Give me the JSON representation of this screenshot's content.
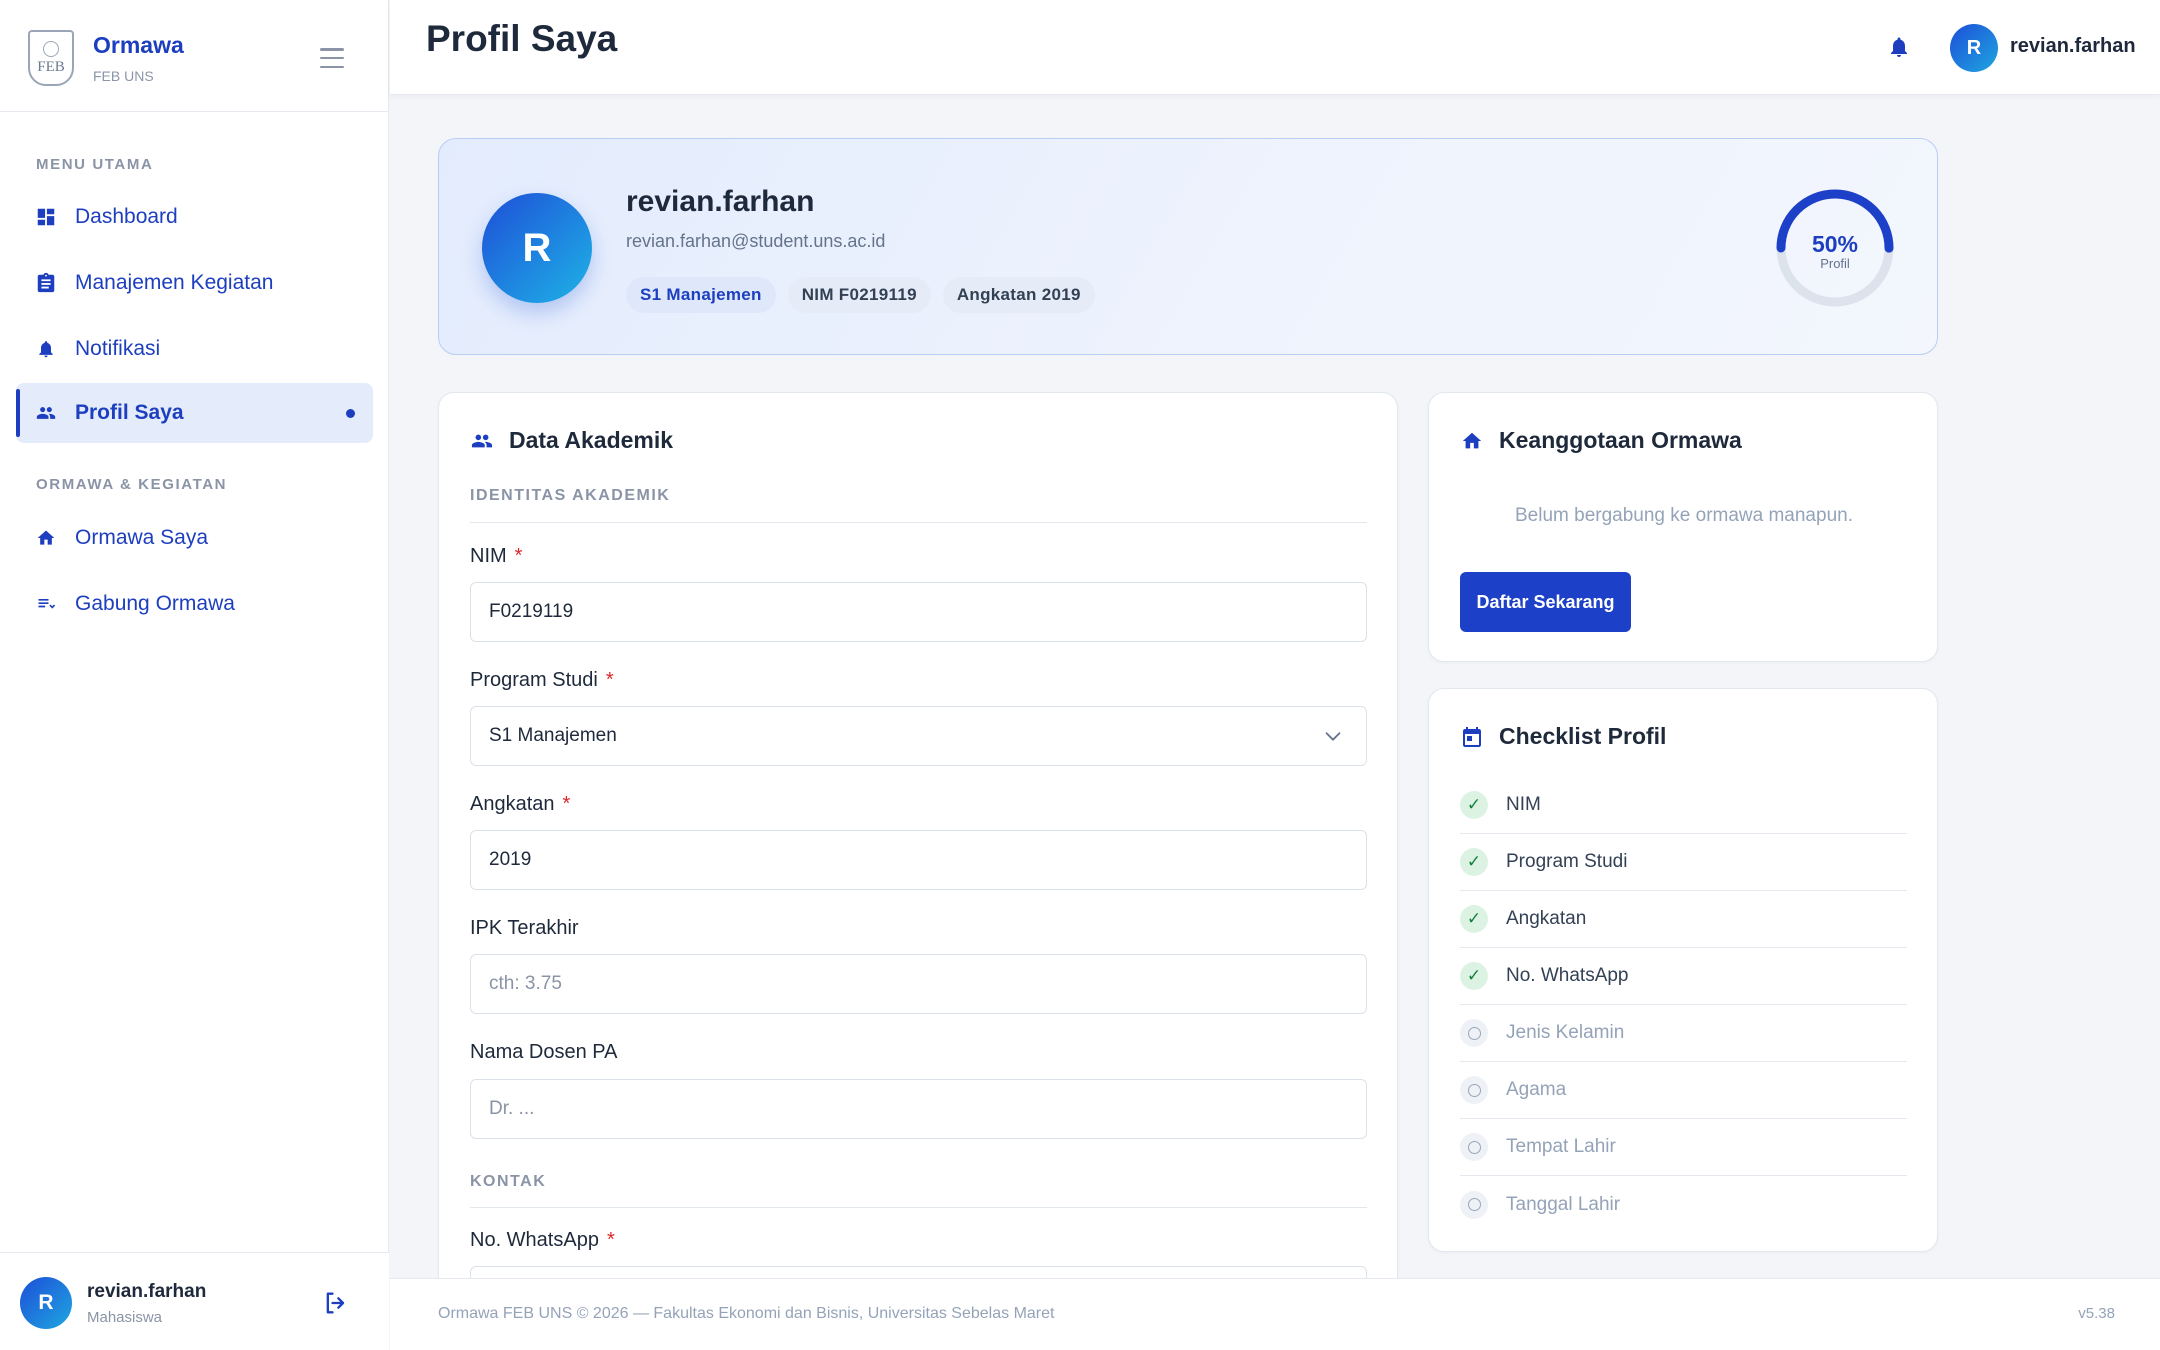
{
  "brand": {
    "title": "Ormawa",
    "subtitle": "FEB UNS",
    "logo_text": "FEB"
  },
  "sidebar": {
    "section_main": "MENU UTAMA",
    "section_ormawa": "ORMAWA & KEGIATAN",
    "items": [
      {
        "label": "Dashboard",
        "icon": "dashboard-icon"
      },
      {
        "label": "Manajemen Kegiatan",
        "icon": "clipboard-icon"
      },
      {
        "label": "Notifikasi",
        "icon": "bell-icon"
      },
      {
        "label": "Profil Saya",
        "icon": "people-icon",
        "active": true
      },
      {
        "label": "Ormawa Saya",
        "icon": "home-icon"
      },
      {
        "label": "Gabung Ormawa",
        "icon": "playlist-add-icon"
      }
    ],
    "user": {
      "initial": "R",
      "name": "revian.farhan",
      "role": "Mahasiswa"
    }
  },
  "topbar": {
    "title": "Profil Saya",
    "user_initial": "R",
    "user_name": "revian.farhan"
  },
  "profile": {
    "initial": "R",
    "name": "revian.farhan",
    "email": "revian.farhan@student.uns.ac.id",
    "tags": [
      "S1 Manajemen",
      "NIM F0219119",
      "Angkatan 2019"
    ],
    "completion_value": "50%",
    "completion_fraction": 0.5,
    "completion_label": "Profil"
  },
  "academic": {
    "title": "Data Akademik",
    "section_identity": "IDENTITAS AKADEMIK",
    "section_contact": "KONTAK",
    "required_mark": "*",
    "fields": {
      "nim": {
        "label": "NIM",
        "value": "F0219119"
      },
      "prodi": {
        "label": "Program Studi",
        "value": "S1 Manajemen"
      },
      "angkatan": {
        "label": "Angkatan",
        "value": "2019"
      },
      "ipk": {
        "label": "IPK Terakhir",
        "placeholder": "cth: 3.75"
      },
      "dosen": {
        "label": "Nama Dosen PA",
        "placeholder": "Dr. ..."
      },
      "whatsapp": {
        "label": "No. WhatsApp"
      }
    }
  },
  "membership": {
    "title": "Keanggotaan Ormawa",
    "empty_text": "Belum bergabung ke ormawa manapun.",
    "button_label": "Daftar Sekarang"
  },
  "checklist": {
    "title": "Checklist Profil",
    "done_mark": "✓",
    "items": [
      {
        "label": "NIM",
        "done": true
      },
      {
        "label": "Program Studi",
        "done": true
      },
      {
        "label": "Angkatan",
        "done": true
      },
      {
        "label": "No. WhatsApp",
        "done": true
      },
      {
        "label": "Jenis Kelamin",
        "done": false
      },
      {
        "label": "Agama",
        "done": false
      },
      {
        "label": "Tempat Lahir",
        "done": false
      },
      {
        "label": "Tanggal Lahir",
        "done": false
      }
    ]
  },
  "footer": {
    "text": "Ormawa FEB UNS © 2026 — Fakultas Ekonomi dan Bisnis, Universitas Sebelas Maret",
    "version": "v5.38"
  },
  "colors": {
    "accent": "#1d3fbf",
    "success": "#15803d",
    "required": "#dc2626"
  }
}
